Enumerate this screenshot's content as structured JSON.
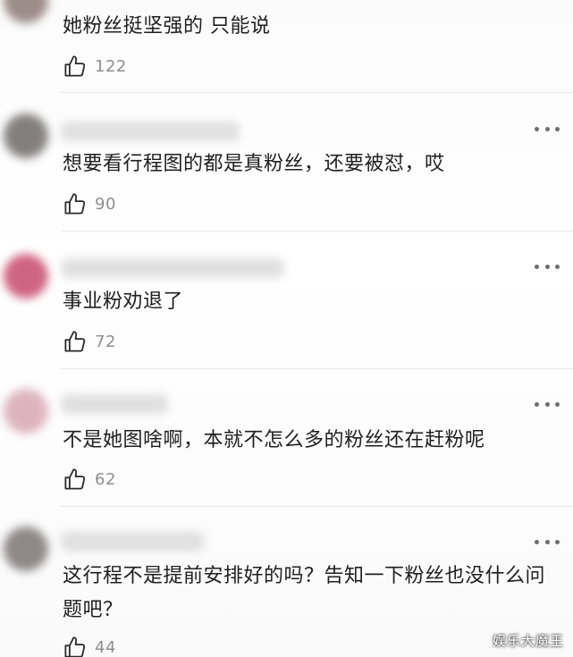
{
  "comments": [
    {
      "text": "她粉丝挺坚强的 只能说",
      "likes": "122",
      "colors": [
        "#8c7a76"
      ]
    },
    {
      "text": "想要看行程图的都是真粉丝，还要被怼，哎",
      "likes": "90",
      "colors": [
        "#6e6a69"
      ]
    },
    {
      "text": "事业粉劝退了",
      "likes": "72",
      "colors": [
        "#c7496d"
      ]
    },
    {
      "text": "不是她图啥啊，本就不怎么多的粉丝还在赶粉呢",
      "likes": "62",
      "colors": [
        "#d8a8b4"
      ]
    },
    {
      "text": "这行程不是提前安排好的吗？告知一下粉丝也没什么问题吧？",
      "likes": "44",
      "colors": [
        "#7c7475"
      ]
    }
  ],
  "watermark": "娱乐大魔王",
  "icons": {
    "more": "more-dots-icon",
    "like": "thumbs-up-icon"
  }
}
